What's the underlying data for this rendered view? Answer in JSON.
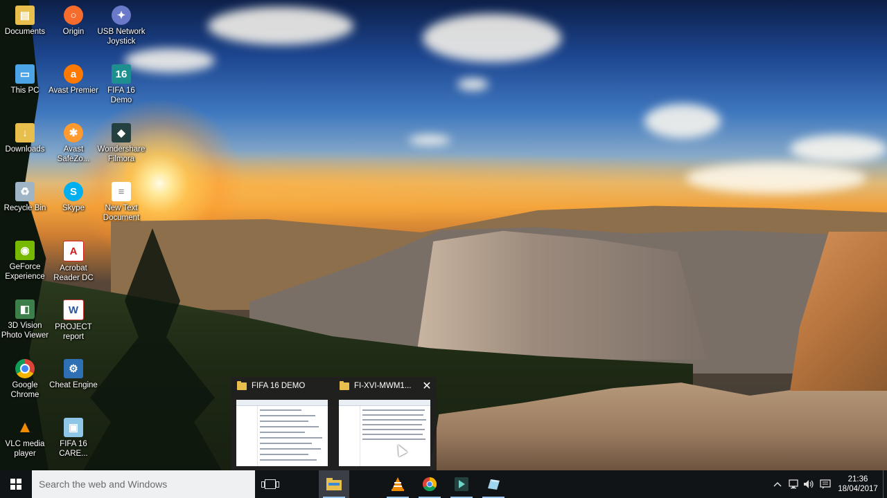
{
  "desktop": {
    "icons": [
      {
        "label": "Documents",
        "icon": "folder-documents-icon"
      },
      {
        "label": "Origin",
        "icon": "origin-icon"
      },
      {
        "label": "USB Network Joystick",
        "icon": "joystick-icon"
      },
      {
        "label": "This PC",
        "icon": "computer-icon"
      },
      {
        "label": "Avast Premier",
        "icon": "avast-icon"
      },
      {
        "label": "FIFA 16 Demo",
        "icon": "fifa-icon"
      },
      {
        "label": "Downloads",
        "icon": "folder-downloads-icon"
      },
      {
        "label": "Avast SafeZo...",
        "icon": "avast-safezone-icon"
      },
      {
        "label": "Wondershare Filmora",
        "icon": "filmora-icon"
      },
      {
        "label": "Recycle Bin",
        "icon": "recycle-bin-icon"
      },
      {
        "label": "Skype",
        "icon": "skype-icon"
      },
      {
        "label": "New Text Document",
        "icon": "text-document-icon"
      },
      {
        "label": "GeForce Experience",
        "icon": "geforce-icon"
      },
      {
        "label": "Acrobat Reader DC",
        "icon": "acrobat-icon"
      },
      {
        "label": "3D Vision Photo Viewer",
        "icon": "3d-vision-icon"
      },
      {
        "label": "PROJECT report",
        "icon": "word-document-icon"
      },
      {
        "label": "Google Chrome",
        "icon": "chrome-icon"
      },
      {
        "label": "Cheat Engine",
        "icon": "cheat-engine-icon"
      },
      {
        "label": "VLC media player",
        "icon": "vlc-icon"
      },
      {
        "label": "FIFA 16 CARE...",
        "icon": "fifa-career-icon"
      }
    ]
  },
  "thumbnails": [
    {
      "title": "FIFA 16 DEMO",
      "icon": "folder-icon"
    },
    {
      "title": "FI-XVI-MWM1...",
      "icon": "folder-icon",
      "close": "✕"
    }
  ],
  "taskbar": {
    "search_placeholder": "Search the web and Windows",
    "apps": [
      {
        "name": "file-explorer",
        "icon": "file-explorer-icon",
        "active": true
      },
      {
        "name": "vlc",
        "icon": "vlc-icon",
        "active": false
      },
      {
        "name": "chrome",
        "icon": "chrome-icon",
        "active": false
      },
      {
        "name": "filmora",
        "icon": "filmora-icon",
        "active": false
      },
      {
        "name": "cheat-engine",
        "icon": "cheat-engine-icon",
        "active": false
      }
    ],
    "tray_icons": [
      "chevron-up-icon",
      "network-icon",
      "volume-icon",
      "action-center-icon"
    ],
    "clock": {
      "time": "21:36",
      "date": "18/04/2017"
    }
  },
  "colors": {
    "taskbar_bg": "#101417",
    "search_bg": "#eef0f2",
    "active_app_bg": "#3b3f45",
    "running_indicator": "#9cc7ee"
  }
}
